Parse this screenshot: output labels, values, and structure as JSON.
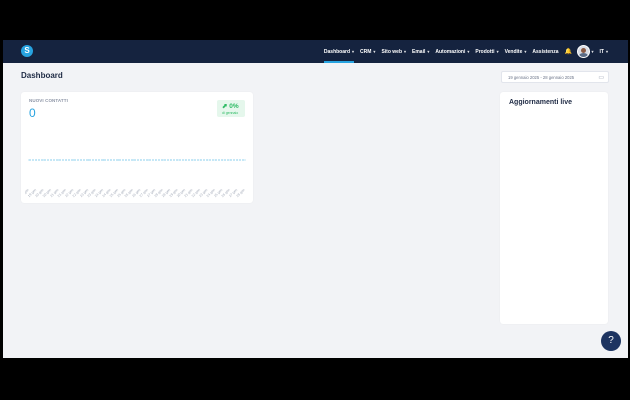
{
  "app": {
    "logo_letter": "S",
    "brand_color": "#27a3e0",
    "nav_bg": "#15233f"
  },
  "nav": {
    "items": [
      {
        "label": "Dashboard",
        "active": true
      },
      {
        "label": "CRM"
      },
      {
        "label": "Sito web"
      },
      {
        "label": "Email"
      },
      {
        "label": "Automazioni"
      },
      {
        "label": "Prodotti"
      },
      {
        "label": "Vendite"
      },
      {
        "label": "Assistenza"
      }
    ],
    "language": "IT"
  },
  "page": {
    "title": "Dashboard",
    "date_range": "19 gennaio 2025 - 28 gennaio 2025"
  },
  "contacts_card": {
    "label": "NUOVI CONTATTI",
    "value": "0",
    "delta": "0%",
    "delta_sub": "di gennaio"
  },
  "live_card": {
    "title": "Aggiornamenti live"
  },
  "chart_data": {
    "type": "line",
    "x": [
      "19 gen",
      "19 gen",
      "20 gen",
      "20 gen",
      "21 gen",
      "21 gen",
      "22 gen",
      "22 gen",
      "23 gen",
      "23 gen",
      "24 gen",
      "24 gen",
      "25 gen",
      "25 gen",
      "26 gen",
      "26 gen",
      "27 gen",
      "27 gen",
      "28 gen",
      "28 gen",
      "19 gen",
      "20 gen",
      "21 gen",
      "22 gen",
      "23 gen",
      "24 gen",
      "25 gen",
      "26 gen",
      "27 gen",
      "28 gen"
    ],
    "series": [
      {
        "values": [
          0,
          0,
          0,
          0,
          0,
          0,
          0,
          0,
          0,
          0,
          0,
          0,
          0,
          0,
          0,
          0,
          0,
          0,
          0,
          0,
          0,
          0,
          0,
          0,
          0,
          0,
          0,
          0,
          0,
          0
        ]
      }
    ],
    "line_color": "#8fd0ee"
  },
  "help": {
    "label": "?"
  }
}
